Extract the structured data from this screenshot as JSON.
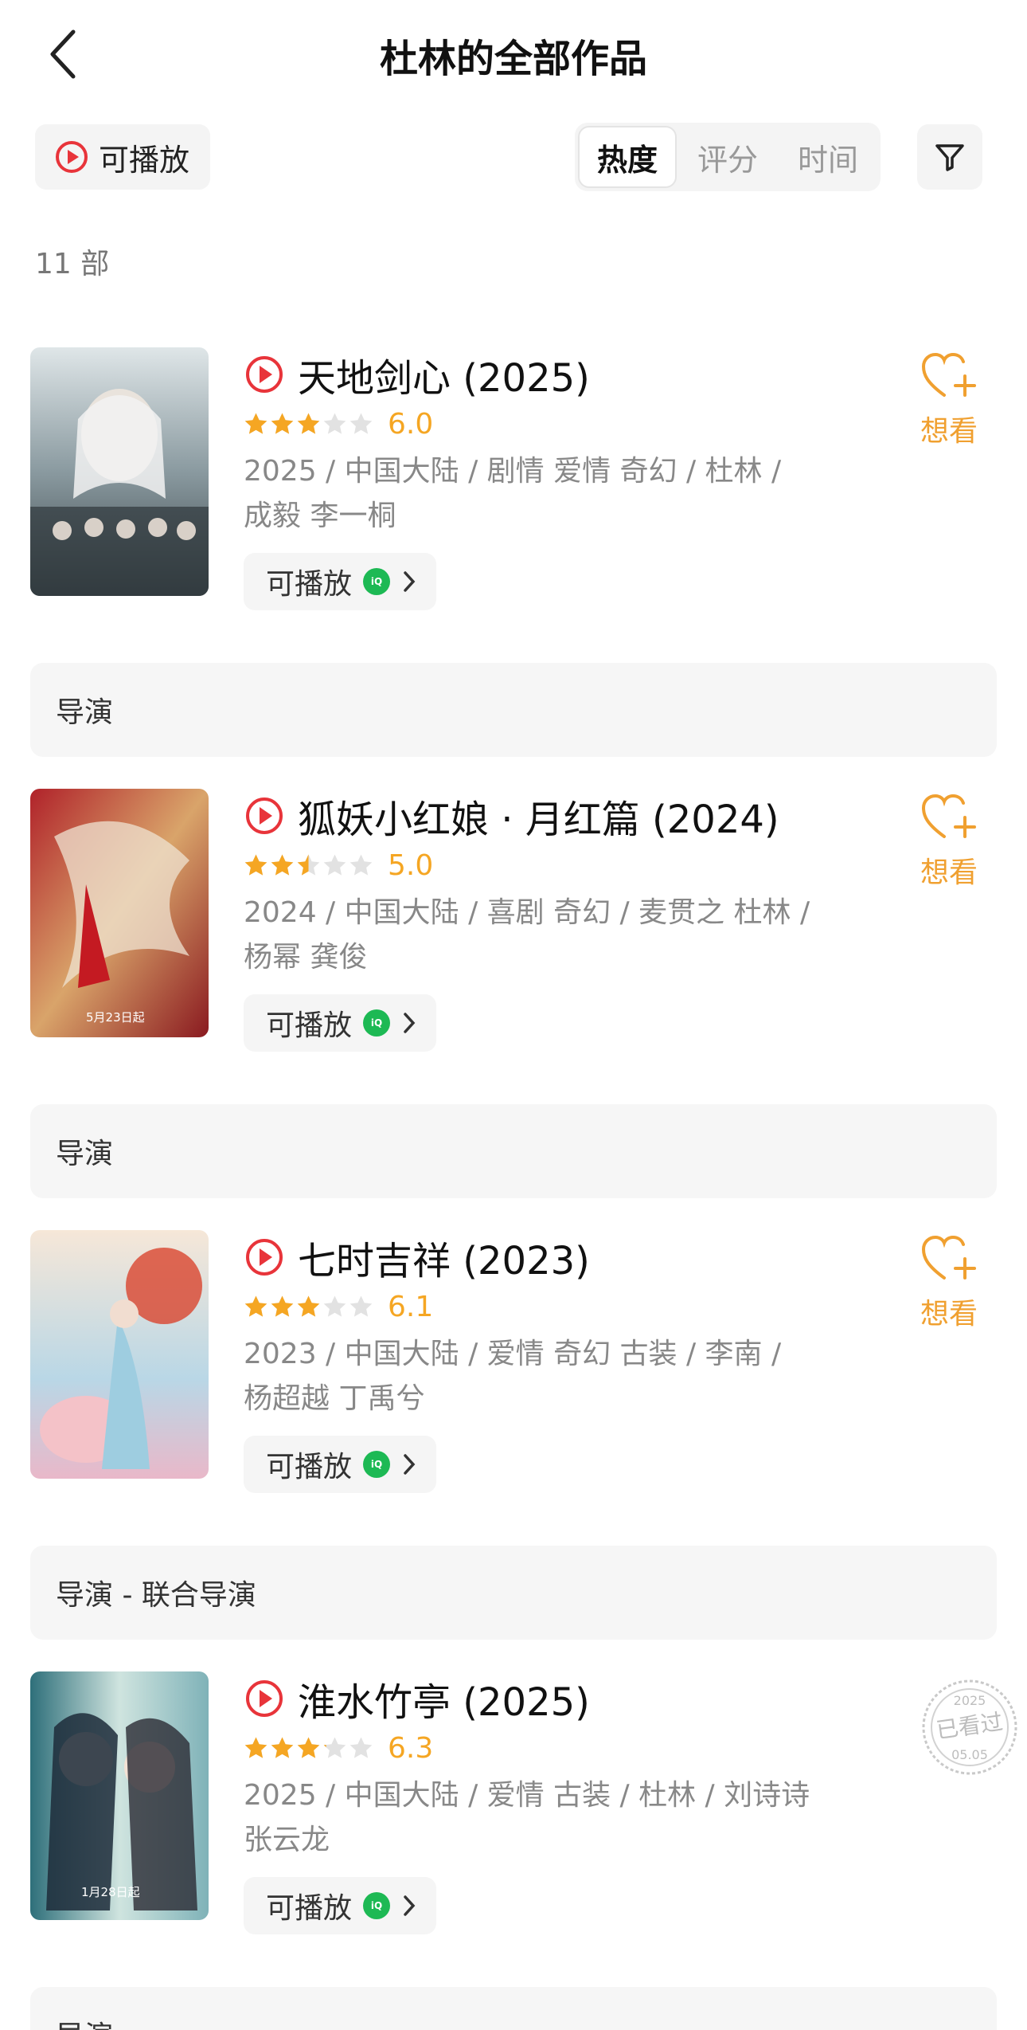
{
  "header": {
    "title": "杜林的全部作品"
  },
  "toolbar": {
    "playable_label": "可播放",
    "sort_tabs": [
      "热度",
      "评分",
      "时间"
    ],
    "active_sort": "热度"
  },
  "count_label": "11 部",
  "items": [
    {
      "title": "天地剑心 (2025)",
      "rating": 6.0,
      "rating_text": "6.0",
      "meta_line1": "2025 / 中国大陆 / 剧情 爱情 奇幻 / 杜林 /",
      "meta_line2": "成毅 李一桐",
      "play_label": "可播放",
      "platform_icon": "iqiyi-icon",
      "want_label": "想看",
      "role": "导演"
    },
    {
      "title": "狐妖小红娘 · 月红篇 (2024)",
      "rating": 5.0,
      "rating_text": "5.0",
      "meta_line1": "2024 / 中国大陆 / 喜剧 奇幻 / 麦贯之 杜林 /",
      "meta_line2": "杨幂 龚俊",
      "play_label": "可播放",
      "platform_icon": "iqiyi-icon",
      "want_label": "想看",
      "role": "导演",
      "poster_caption": "5月23日起"
    },
    {
      "title": "七时吉祥 (2023)",
      "rating": 6.1,
      "rating_text": "6.1",
      "meta_line1": "2023 / 中国大陆 / 爱情 奇幻 古装 / 李南 /",
      "meta_line2": "杨超越 丁禹兮",
      "play_label": "可播放",
      "platform_icon": "iqiyi-icon",
      "want_label": "想看",
      "role": "导演 - 联合导演"
    },
    {
      "title": "淮水竹亭 (2025)",
      "rating": 6.3,
      "rating_text": "6.3",
      "meta_line1": "2025 / 中国大陆 / 爱情 古装 / 杜林 / 刘诗诗",
      "meta_line2": "张云龙",
      "play_label": "可播放",
      "platform_icon": "iqiyi-icon",
      "watched_stamp": {
        "year": "2025",
        "text": "已看过",
        "date": "05.05"
      },
      "role": "导演",
      "poster_caption": "1月28日起"
    }
  ],
  "colors": {
    "accent": "#f0a030",
    "star": "#f5a623",
    "play_red": "#e8343a",
    "iqiyi_green": "#1db954"
  }
}
